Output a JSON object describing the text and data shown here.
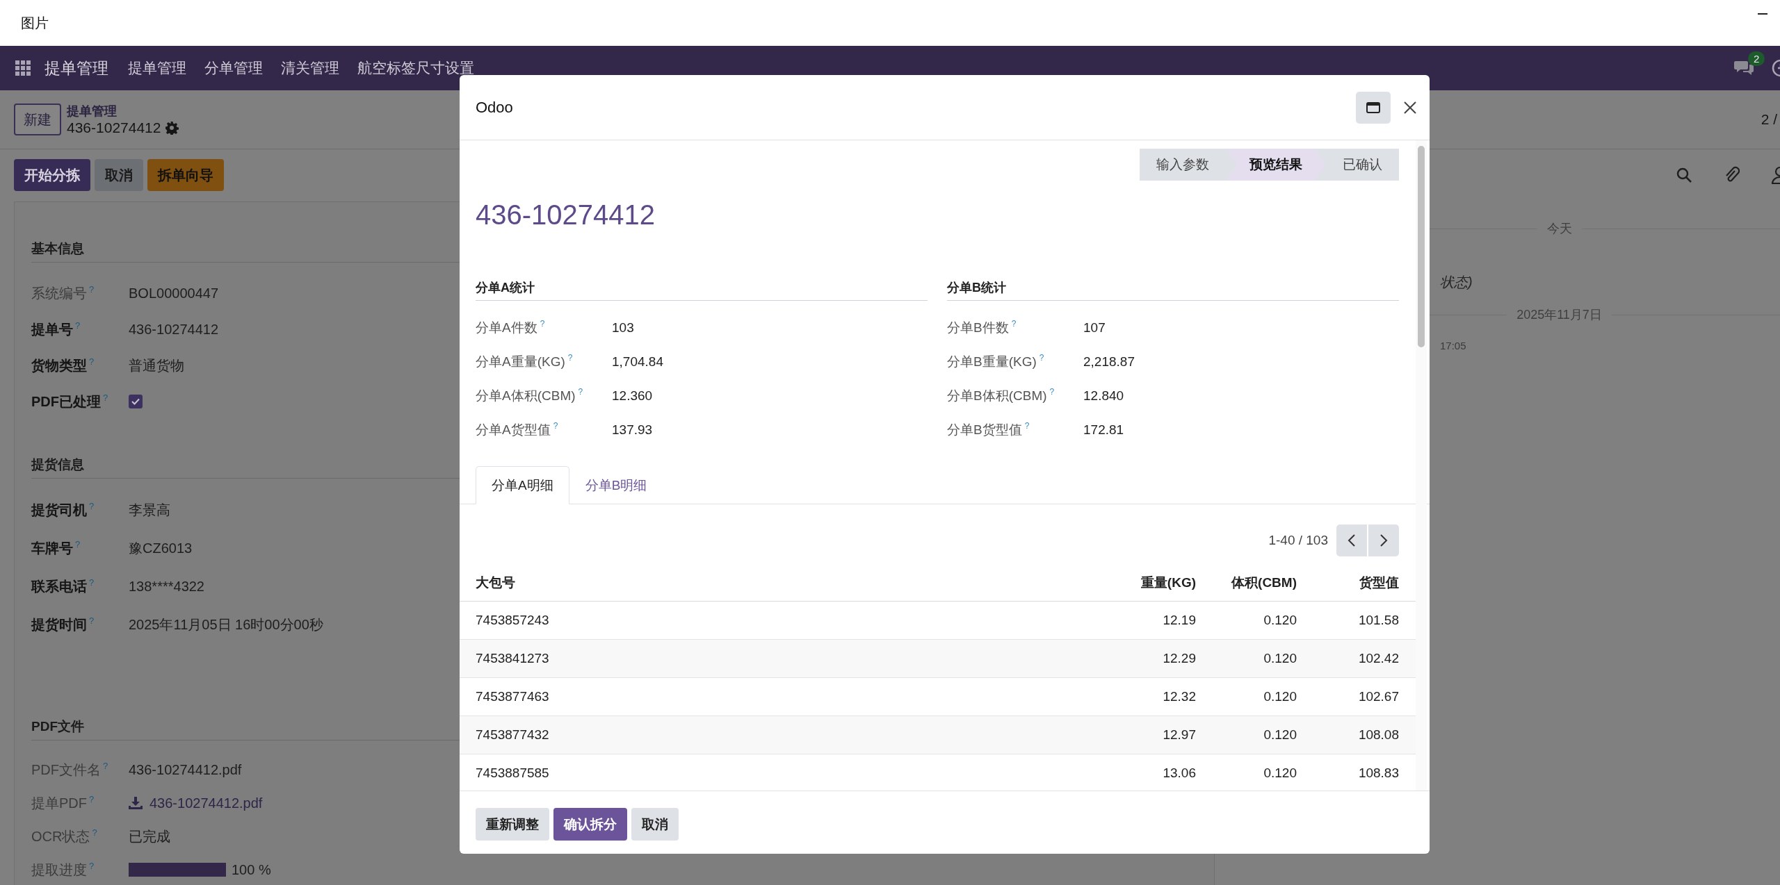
{
  "window": {
    "title": "图片"
  },
  "navbar": {
    "app_name": "提单管理",
    "menu": [
      "提单管理",
      "分单管理",
      "清关管理",
      "航空标签尺寸设置"
    ],
    "message_count": "2"
  },
  "control_panel": {
    "new_button": "新建",
    "breadcrumb": "提单管理",
    "record_title": "436-10274412",
    "pager": "2 /"
  },
  "action_buttons": [
    {
      "label": "开始分拣",
      "kind": "primary"
    },
    {
      "label": "取消",
      "kind": "secondary"
    },
    {
      "label": "拆单向导",
      "kind": "warning"
    }
  ],
  "form": {
    "sections": [
      {
        "title": "基本信息",
        "fields": [
          {
            "label": "系统编号$^{?}$",
            "kind": "text",
            "readonly": true,
            "value": "BOL00000447"
          },
          {
            "label": "提单号$^{?}$",
            "kind": "text",
            "readonly": false,
            "value": "436-10274412"
          },
          {
            "label": "货物类型$^{?}$",
            "kind": "text",
            "readonly": false,
            "value": "普通货物"
          },
          {
            "label": "PDF已处理$^{?}$",
            "kind": "checkbox",
            "readonly": false,
            "checked": true
          }
        ]
      },
      {
        "title": "提货信息",
        "fields": [
          {
            "label": "提货司机$^{?}$",
            "kind": "text",
            "readonly": false,
            "value": "李景高"
          },
          {
            "label": "车牌号$^{?}$",
            "kind": "text",
            "readonly": false,
            "value": "豫CZ6013"
          },
          {
            "label": "联系电话$^{?}$",
            "kind": "text",
            "readonly": false,
            "value": "138****4322"
          },
          {
            "label": "提货时间$^{?}$",
            "kind": "text",
            "readonly": false,
            "value": "2025年11月05日 16时00分00秒"
          }
        ]
      },
      {
        "title": "PDF文件",
        "fields": [
          {
            "label": "PDF文件名$^{?}$",
            "kind": "text",
            "readonly": true,
            "value": "436-10274412.pdf"
          },
          {
            "label": "提单PDF$^{?}$",
            "kind": "file",
            "readonly": true,
            "value": "436-10274412.pdf"
          },
          {
            "label": "OCR状态$^{?}$",
            "kind": "text",
            "readonly": true,
            "value": "已完成"
          },
          {
            "label": "提取进度$^{?}$",
            "kind": "progress",
            "readonly": true,
            "level": 1.0,
            "value": "100 %"
          }
        ]
      }
    ]
  },
  "chatter": {
    "items": [
      {
        "kind": "date",
        "text": "今天"
      },
      {
        "kind": "message",
        "text": "状态)"
      },
      {
        "kind": "date",
        "text": "2025年11月7日"
      },
      {
        "kind": "time",
        "text": "17:05"
      }
    ]
  },
  "dialog": {
    "title": "Odoo",
    "steps": [
      {
        "label": "输入参数",
        "selected": false
      },
      {
        "label": "预览结果",
        "selected": true
      },
      {
        "label": "已确认",
        "selected": false
      }
    ],
    "record_title": "436-10274412",
    "stats": [
      {
        "title": "分单A统计",
        "rows": [
          {
            "label": "分单A件数$^{?}$",
            "value": "103"
          },
          {
            "label": "分单A重量(KG)$^{?}$",
            "value": "1,704.84"
          },
          {
            "label": "分单A体积(CBM)$^{?}$",
            "value": "12.360"
          },
          {
            "label": "分单A货型值$^{?}$",
            "value": "137.93"
          }
        ]
      },
      {
        "title": "分单B统计",
        "rows": [
          {
            "label": "分单B件数$^{?}$",
            "value": "107"
          },
          {
            "label": "分单B重量(KG)$^{?}$",
            "value": "2,218.87"
          },
          {
            "label": "分单B体积(CBM)$^{?}$",
            "value": "12.840"
          },
          {
            "label": "分单B货型值$^{?}$",
            "value": "172.81"
          }
        ]
      }
    ],
    "tabs": [
      {
        "label": "分单A明细",
        "selected": true
      },
      {
        "label": "分单B明细",
        "selected": false
      }
    ],
    "pager": "1-40 / 103",
    "table": {
      "columns": [
        "大包号",
        "重量(KG)",
        "体积(CBM)",
        "货型值"
      ],
      "rows": [
        [
          "7453857243",
          "12.19",
          "0.120",
          "101.58"
        ],
        [
          "7453841273",
          "12.29",
          "0.120",
          "102.42"
        ],
        [
          "7453877463",
          "12.32",
          "0.120",
          "102.67"
        ],
        [
          "7453877432",
          "12.97",
          "0.120",
          "108.08"
        ],
        [
          "7453887585",
          "13.06",
          "0.120",
          "108.83"
        ]
      ]
    },
    "footer_buttons": [
      {
        "label": "重新调整",
        "kind": "secondary"
      },
      {
        "label": "确认拆分",
        "kind": "primary"
      },
      {
        "label": "取消",
        "kind": "secondary"
      }
    ]
  }
}
